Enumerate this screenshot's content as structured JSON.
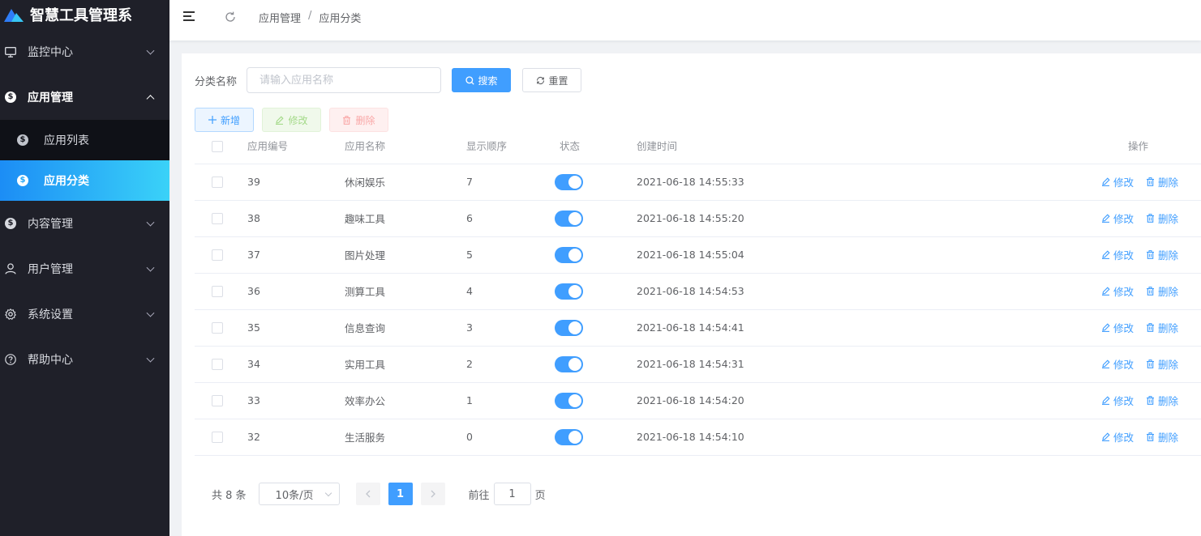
{
  "app": {
    "title": "智慧工具管理系",
    "logo_icon": "mountain-logo-icon",
    "accent": "#409eff"
  },
  "sidebar": {
    "items": [
      {
        "label": "监控中心",
        "icon": "monitor-icon"
      },
      {
        "label": "应用管理",
        "icon": "dollar-circle-icon",
        "expanded": true,
        "children": [
          {
            "label": "应用列表",
            "icon": "dollar-circle-icon"
          },
          {
            "label": "应用分类",
            "icon": "dollar-circle-icon",
            "active": true
          }
        ]
      },
      {
        "label": "内容管理",
        "icon": "dollar-circle-icon"
      },
      {
        "label": "用户管理",
        "icon": "user-icon"
      },
      {
        "label": "系统设置",
        "icon": "gear-icon"
      },
      {
        "label": "帮助中心",
        "icon": "question-circle-icon"
      }
    ]
  },
  "header": {
    "breadcrumb": [
      "应用管理",
      "应用分类"
    ],
    "separator": "/"
  },
  "filter": {
    "label": "分类名称",
    "placeholder": "请输入应用名称",
    "search_label": "搜索",
    "reset_label": "重置"
  },
  "toolbar": {
    "add_label": "新增",
    "edit_label": "修改",
    "delete_label": "删除"
  },
  "table": {
    "headers": {
      "id": "应用编号",
      "name": "应用名称",
      "order": "显示顺序",
      "state": "状态",
      "created": "创建时间",
      "actions": "操作"
    },
    "edit_label": "修改",
    "delete_label": "删除",
    "rows": [
      {
        "id": "39",
        "name": "休闲娱乐",
        "order": "7",
        "enabled": true,
        "created": "2021-06-18 14:55:33"
      },
      {
        "id": "38",
        "name": "趣味工具",
        "order": "6",
        "enabled": true,
        "created": "2021-06-18 14:55:20"
      },
      {
        "id": "37",
        "name": "图片处理",
        "order": "5",
        "enabled": true,
        "created": "2021-06-18 14:55:04"
      },
      {
        "id": "36",
        "name": "测算工具",
        "order": "4",
        "enabled": true,
        "created": "2021-06-18 14:54:53"
      },
      {
        "id": "35",
        "name": "信息查询",
        "order": "3",
        "enabled": true,
        "created": "2021-06-18 14:54:41"
      },
      {
        "id": "34",
        "name": "实用工具",
        "order": "2",
        "enabled": true,
        "created": "2021-06-18 14:54:31"
      },
      {
        "id": "33",
        "name": "效率办公",
        "order": "1",
        "enabled": true,
        "created": "2021-06-18 14:54:20"
      },
      {
        "id": "32",
        "name": "生活服务",
        "order": "0",
        "enabled": true,
        "created": "2021-06-18 14:54:10"
      }
    ]
  },
  "pagination": {
    "total_text": "共 8 条",
    "page_size": "10条/页",
    "current_page": "1",
    "goto_prefix": "前往",
    "goto_value": "1",
    "goto_suffix": "页"
  }
}
